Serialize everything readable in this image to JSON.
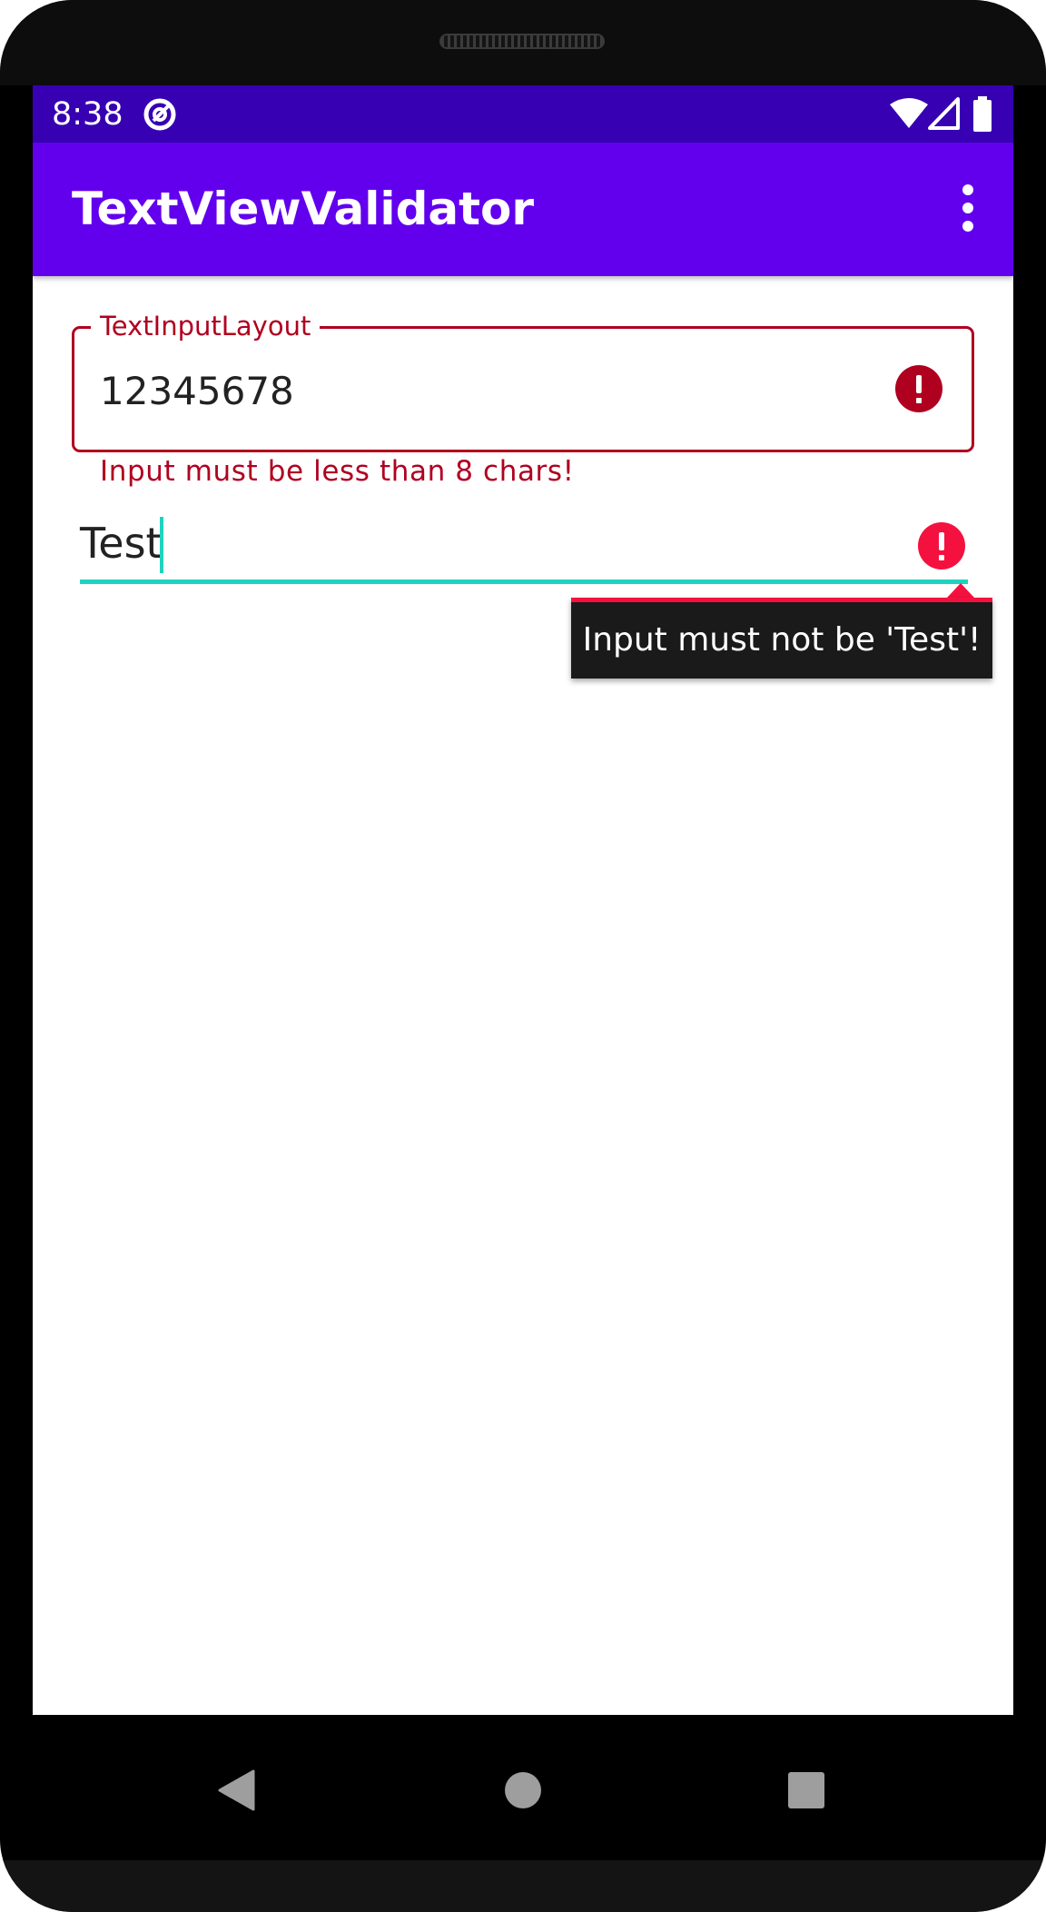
{
  "status_bar": {
    "time": "8:38",
    "icons": [
      "do-not-disturb-icon",
      "wifi-icon",
      "signal-icon",
      "battery-icon"
    ]
  },
  "app_bar": {
    "title": "TextViewValidator",
    "menu_icon": "overflow-menu-icon"
  },
  "outlined_field": {
    "label": "TextInputLayout",
    "value": "12345678",
    "error": "Input must be less than 8 chars!",
    "error_icon": "error-icon"
  },
  "plain_field": {
    "value": "Test",
    "error_popup": "Input must not be 'Test'!",
    "error_icon": "error-icon"
  },
  "nav_bar": {
    "icons": [
      "back-icon",
      "home-icon",
      "recents-icon"
    ]
  },
  "colors": {
    "status_bar": "#3700b3",
    "app_bar": "#6200ee",
    "error": "#b00020",
    "error_bright": "#f5113f",
    "accent": "#1fd3c0",
    "popup_bg": "#1a1a1a"
  }
}
